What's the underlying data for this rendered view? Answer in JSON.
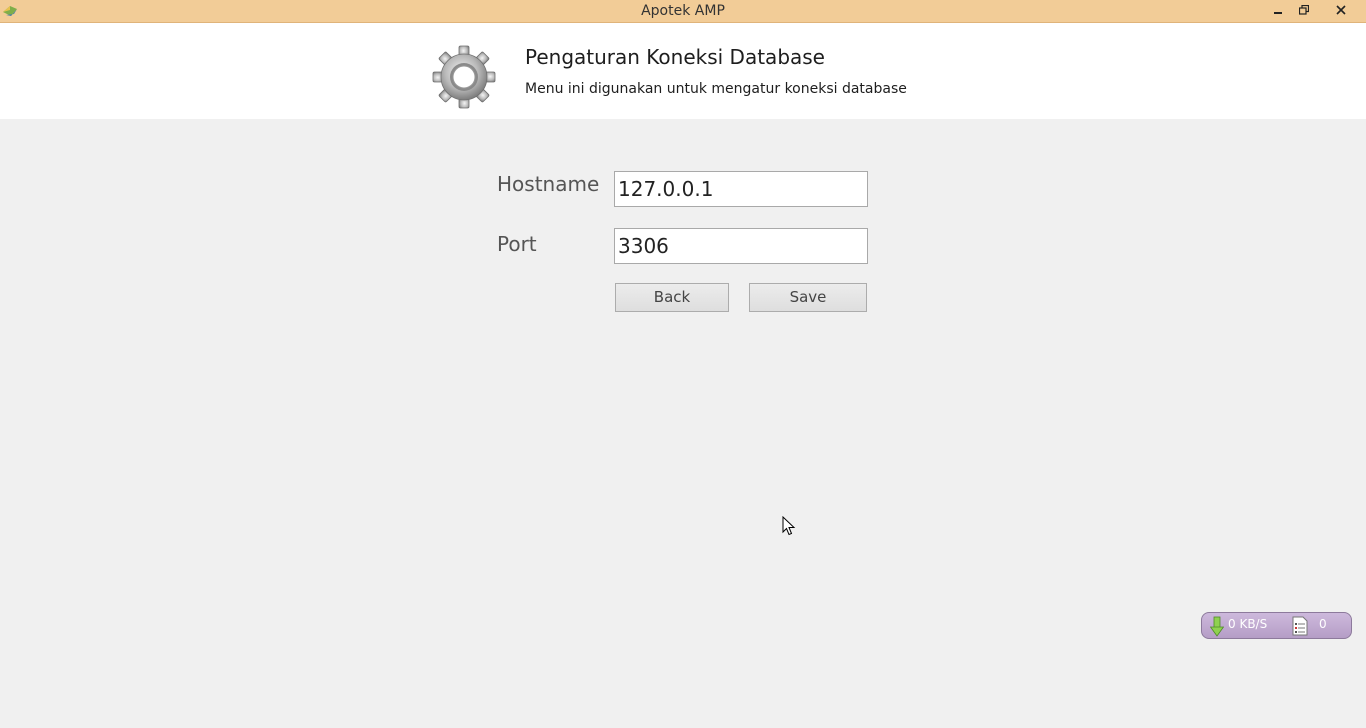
{
  "window": {
    "title": "Apotek AMP",
    "icons": {
      "app": "app-logo-icon",
      "minimize": "minimize-icon",
      "maximize": "restore-icon",
      "close": "close-icon"
    },
    "accent_color": "#f2cc97"
  },
  "header": {
    "icon": "gear-icon",
    "title": "Pengaturan Koneksi Database",
    "subtitle": "Menu ini digunakan untuk mengatur koneksi database"
  },
  "form": {
    "hostname_label": "Hostname",
    "hostname_value": "127.0.0.1",
    "port_label": "Port",
    "port_value": "3306",
    "back_label": "Back",
    "save_label": "Save"
  },
  "download_widget": {
    "speed": "0 KB/S",
    "count": "0",
    "icons": {
      "download": "download-arrow-icon",
      "list": "document-list-icon"
    }
  }
}
